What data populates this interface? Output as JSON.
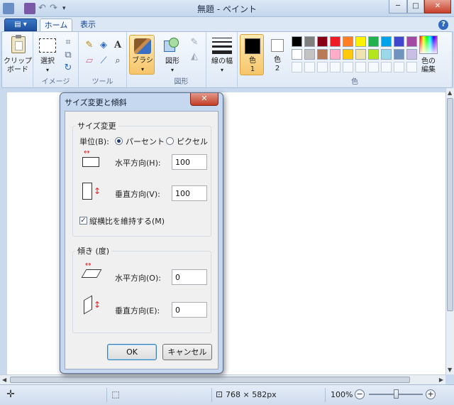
{
  "window": {
    "title": "無題 - ペイント",
    "minimize_glyph": "─",
    "maximize_glyph": "□",
    "close_glyph": "✕"
  },
  "tabs": {
    "file_glyph": "▤ ▾",
    "home": "ホーム",
    "view": "表示",
    "help_glyph": "?"
  },
  "ribbon": {
    "clipboard": {
      "label": "クリップ\nボード"
    },
    "image": {
      "select_label": "選択",
      "group_label": "イメージ"
    },
    "tools": {
      "group_label": "ツール"
    },
    "brush": {
      "label": "ブラシ"
    },
    "shapes": {
      "label": "図形",
      "group_label": "図形"
    },
    "size": {
      "label": "線の幅"
    },
    "color1": {
      "label": "色\n1"
    },
    "color2": {
      "label": "色\n2"
    },
    "colors": {
      "group_label": "色"
    },
    "edit_colors": {
      "label": "色の\n編集"
    }
  },
  "palette": {
    "row1": [
      "#000000",
      "#7f7f7f",
      "#880015",
      "#ed1c24",
      "#ff7f27",
      "#fff200",
      "#22b14c",
      "#00a2e8",
      "#3f48cc",
      "#a349a4"
    ],
    "row2": [
      "#ffffff",
      "#c3c3c3",
      "#b97a57",
      "#ffaec9",
      "#ffc90e",
      "#efe4b0",
      "#b5e61d",
      "#99d9ea",
      "#7092be",
      "#c8bfe7"
    ],
    "primary": "#000000",
    "secondary": "#ffffff"
  },
  "dialog": {
    "title": "サイズ変更と傾斜",
    "close_glyph": "✕",
    "resize": {
      "legend": "サイズ変更",
      "units_label": "単位(B):",
      "percent_label": "パーセント",
      "pixels_label": "ピクセル",
      "selected_unit": "percent",
      "horizontal_label": "水平方向(H):",
      "horizontal_value": "100",
      "vertical_label": "垂直方向(V):",
      "vertical_value": "100",
      "keep_ratio_label": "縦横比を維持する(M)",
      "keep_ratio_checked": true
    },
    "skew": {
      "legend": "傾き (度)",
      "horizontal_label": "水平方向(O):",
      "horizontal_value": "0",
      "vertical_label": "垂直方向(E):",
      "vertical_value": "0"
    },
    "ok_label": "OK",
    "cancel_label": "キャンセル"
  },
  "statusbar": {
    "dimensions": "768 × 582px",
    "zoom": "100%",
    "zoom_level": 0.5,
    "zoom_out_glyph": "−",
    "zoom_in_glyph": "+"
  }
}
